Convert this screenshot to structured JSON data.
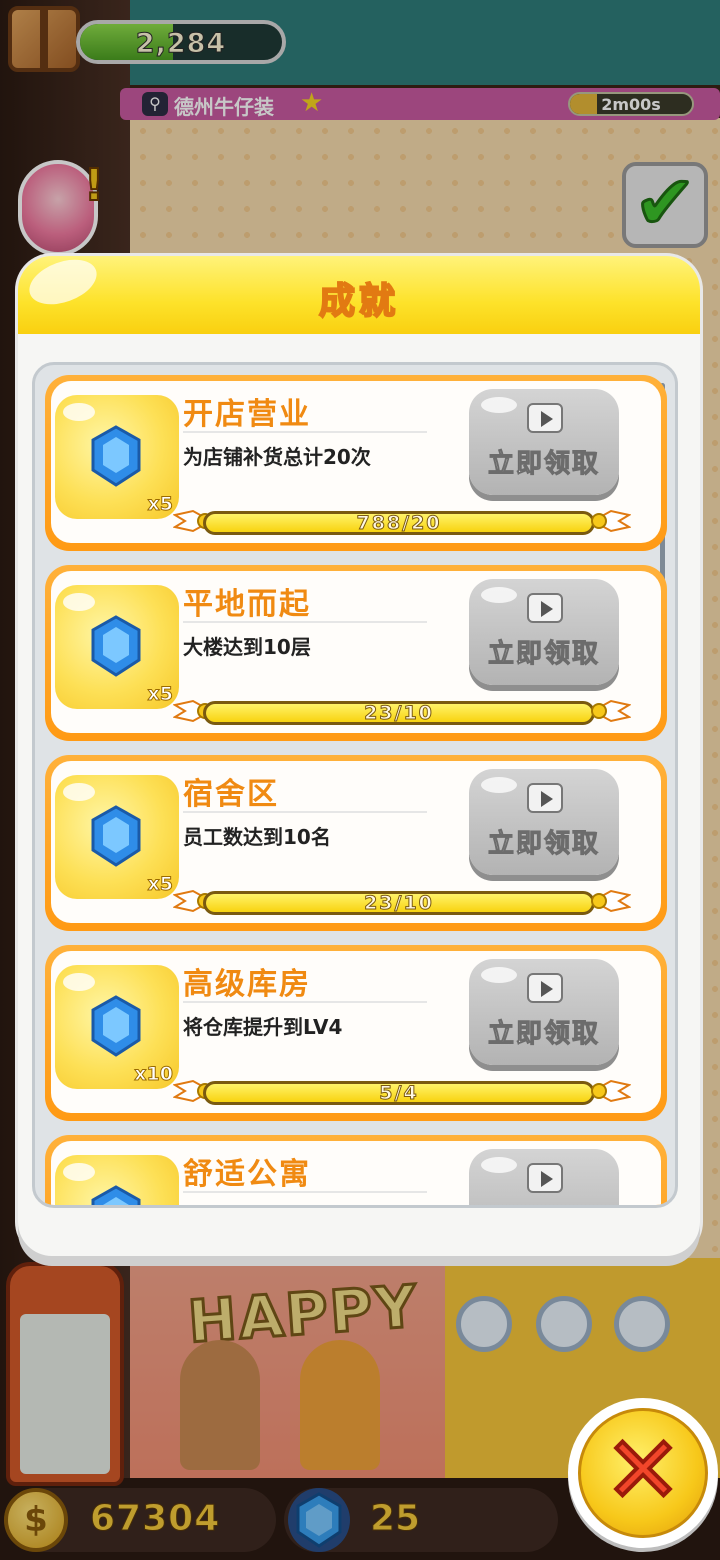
{
  "hud": {
    "top_currency": "2,284",
    "shop_name": "德州牛仔装",
    "shop_timer": "2m00s",
    "coins": "67304",
    "gems": "25",
    "scene_sign": "HAPPY"
  },
  "modal": {
    "title": "成就",
    "claim_label": "立即领取"
  },
  "achievements": [
    {
      "title": "开店营业",
      "desc": "为店铺补货总计20次",
      "reward": "x5",
      "progress": "788/20"
    },
    {
      "title": "平地而起",
      "desc": "大楼达到10层",
      "reward": "x5",
      "progress": "23/10"
    },
    {
      "title": "宿舍区",
      "desc": "员工数达到10名",
      "reward": "x5",
      "progress": "23/10"
    },
    {
      "title": "高级库房",
      "desc": "将仓库提升到LV4",
      "reward": "x10",
      "progress": "5/4"
    },
    {
      "title": "舒适公寓",
      "desc": "",
      "reward": "",
      "progress": ""
    }
  ],
  "colors": {
    "accent_orange": "#f08a12",
    "header_yellow": "#fde22a",
    "claim_gray": "#b3b3b3",
    "gem_blue": "#2f8de8"
  }
}
